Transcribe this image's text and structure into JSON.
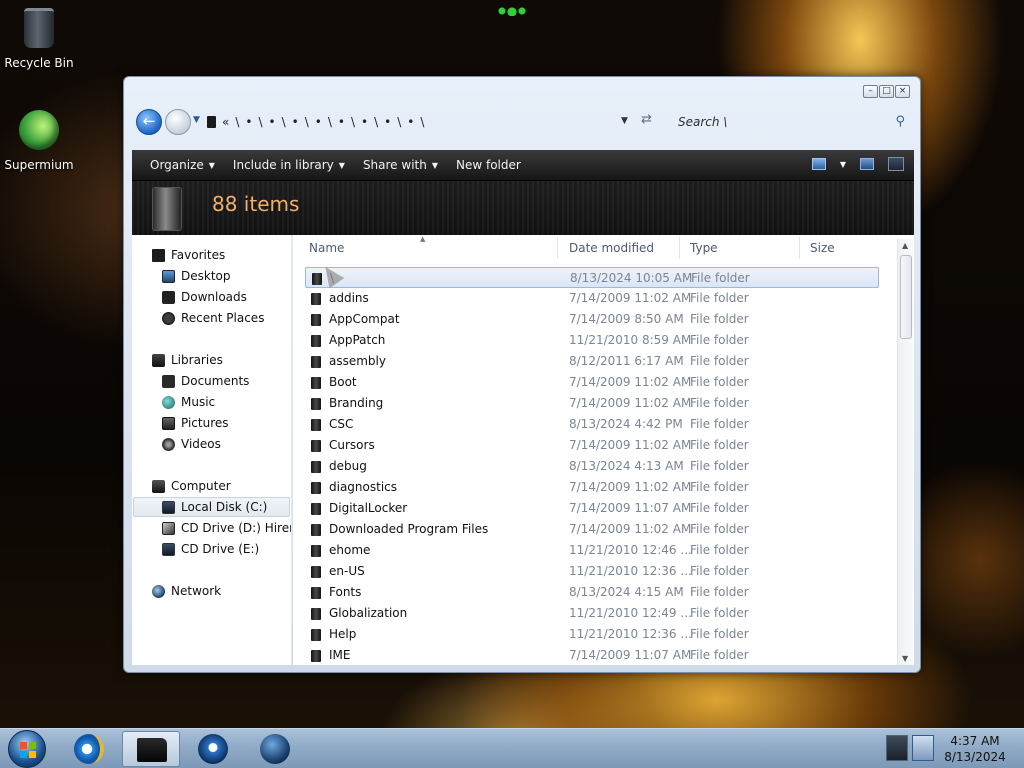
{
  "desktop": {
    "icons": [
      {
        "label": "Recycle Bin",
        "icon": "recycle-bin-icon"
      },
      {
        "label": "Supermium",
        "icon": "supermium-browser-icon"
      }
    ]
  },
  "window": {
    "caption_buttons": {
      "minimize": "–",
      "maximize": "□",
      "close": "×"
    },
    "address": {
      "prefix": "«",
      "crumbs": [
        "\\",
        "•",
        "\\",
        "•",
        "\\",
        "•",
        "\\",
        "•",
        "\\",
        "•",
        "\\",
        "•",
        "\\",
        "•",
        "\\",
        "•",
        "\\"
      ]
    },
    "search": {
      "placeholder": "Search \\"
    },
    "toolbar": {
      "organize": "Organize",
      "include": "Include in library",
      "share": "Share with",
      "new_folder": "New folder"
    },
    "header": {
      "item_count": "88 items"
    },
    "nav": {
      "favorites": "Favorites",
      "desktop": "Desktop",
      "downloads": "Downloads",
      "recent": "Recent Places",
      "libraries": "Libraries",
      "documents": "Documents",
      "music": "Music",
      "pictures": "Pictures",
      "videos": "Videos",
      "computer": "Computer",
      "local_disk": "Local Disk (C:)",
      "cd_d": "CD Drive (D:) Hiren's",
      "cd_e": "CD Drive (E:)",
      "network": "Network"
    },
    "columns": {
      "name": "Name",
      "date": "Date modified",
      "type": "Type",
      "size": "Size"
    },
    "files": [
      {
        "name": "\\",
        "date": "8/13/2024 10:05 AM",
        "type": "File folder"
      },
      {
        "name": "addins",
        "date": "7/14/2009 11:02 AM",
        "type": "File folder"
      },
      {
        "name": "AppCompat",
        "date": "7/14/2009 8:50 AM",
        "type": "File folder"
      },
      {
        "name": "AppPatch",
        "date": "11/21/2010 8:59 AM",
        "type": "File folder"
      },
      {
        "name": "assembly",
        "date": "8/12/2011 6:17 AM",
        "type": "File folder"
      },
      {
        "name": "Boot",
        "date": "7/14/2009 11:02 AM",
        "type": "File folder"
      },
      {
        "name": "Branding",
        "date": "7/14/2009 11:02 AM",
        "type": "File folder"
      },
      {
        "name": "CSC",
        "date": "8/13/2024 4:42 PM",
        "type": "File folder"
      },
      {
        "name": "Cursors",
        "date": "7/14/2009 11:02 AM",
        "type": "File folder"
      },
      {
        "name": "debug",
        "date": "8/13/2024 4:13 AM",
        "type": "File folder"
      },
      {
        "name": "diagnostics",
        "date": "7/14/2009 11:02 AM",
        "type": "File folder"
      },
      {
        "name": "DigitalLocker",
        "date": "7/14/2009 11:07 AM",
        "type": "File folder"
      },
      {
        "name": "Downloaded Program Files",
        "date": "7/14/2009 11:02 AM",
        "type": "File folder"
      },
      {
        "name": "ehome",
        "date": "11/21/2010 12:46 ...",
        "type": "File folder"
      },
      {
        "name": "en-US",
        "date": "11/21/2010 12:36 ...",
        "type": "File folder"
      },
      {
        "name": "Fonts",
        "date": "8/13/2024 4:15 AM",
        "type": "File folder"
      },
      {
        "name": "Globalization",
        "date": "11/21/2010 12:49 ...",
        "type": "File folder"
      },
      {
        "name": "Help",
        "date": "11/21/2010 12:36 ...",
        "type": "File folder"
      },
      {
        "name": "IME",
        "date": "7/14/2009 11:07 AM",
        "type": "File folder"
      }
    ]
  },
  "taskbar": {
    "apps": [
      "internet-explorer-icon",
      "explorer-icon",
      "media-player-icon",
      "globe-icon"
    ],
    "clock": {
      "time": "4:37 AM",
      "date": "8/13/2024"
    }
  }
}
